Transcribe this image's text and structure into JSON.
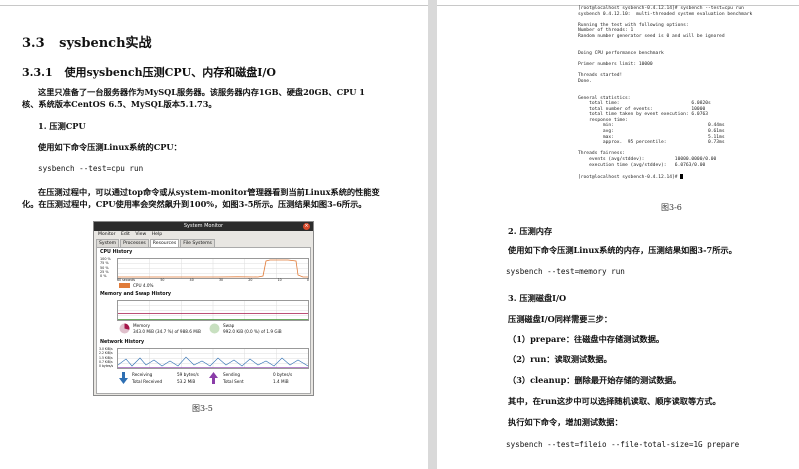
{
  "left_page": {
    "section_number": "3.3",
    "section_title": "sysbench实战",
    "subsection_number": "3.3.1",
    "subsection_title": "使用sysbench压测CPU、内存和磁盘I/O",
    "intro_line1": "这里只准备了一台服务器作为MySQL服务器。该服务器内存1GB、硬盘20GB、CPU  1",
    "intro_line2": "核、系统版本CentOS 6.5、MySQL版本5.1.73。",
    "item1_title": "1. 压测CPU",
    "item1_text": "使用如下命令压测Linux系统的CPU：",
    "item1_command": "sysbench --test=cpu run",
    "item1_para_line1": "在压测过程中，可以通过top命令或从system-monitor管理器看到当前Linux系统的性能变",
    "item1_para_line2": "化。在压测过程中，CPU使用率会突然飙升到100%，如图3-5所示。压测结果如图3-6所示。",
    "figure_caption": "图3-5"
  },
  "system_monitor": {
    "title": "System Monitor",
    "close_glyph": "×",
    "menu": [
      "Monitor",
      "Edit",
      "View",
      "Help"
    ],
    "tabs": [
      "System",
      "Processes",
      "Resources",
      "File Systems"
    ],
    "active_tab": "Resources",
    "cpu_history_label": "CPU History",
    "cpu_legend": "CPU  4.0%",
    "memory_label": "Memory and Swap History",
    "memory_name": "Memory",
    "memory_value": "343.0 MiB (34.7 %) of 988.6 MiB",
    "swap_name": "Swap",
    "swap_value": "992.0 KiB (0.0 %) of 1.9 GiB",
    "network_label": "Network History",
    "receiving_label": "Receiving",
    "receiving_rate": "59 bytes/s",
    "total_received_label": "Total Received",
    "total_received": "53.2 MiB",
    "sending_label": "Sending",
    "sending_rate": "0 bytes/s",
    "total_sent_label": "Total Sent",
    "total_sent": "1.4 MiB",
    "y_ticks_percent": [
      "100 %",
      "75 %",
      "50 %",
      "25 %",
      "0 %"
    ],
    "x_ticks": [
      "60 seconds",
      "50",
      "40",
      "30",
      "20",
      "10",
      "0"
    ],
    "net_ticks": [
      "3.0 KiB/s",
      "2.2 KiB/s",
      "1.5 KiB/s",
      "0.7 KiB/s",
      "0 bytes/s"
    ],
    "colors": {
      "cpu": "#e07b39",
      "memory": "#a6174a",
      "swap": "#3a8e2e",
      "receiving": "#2e6fb3",
      "sending": "#8a3da8"
    }
  },
  "terminal": {
    "lines": [
      "[root@localhost sysbench-0.4.12.14]# sysbench --test=cpu run",
      "sysbench 0.4.12.10:  multi-threaded system evaluation benchmark",
      "",
      "Running the test with following options:",
      "Number of threads: 1",
      "Random number generator seed is 0 and will be ignored",
      "",
      "",
      "Doing CPU performance benchmark",
      "",
      "Primer numbers limit: 10000",
      "",
      "Threads started!",
      "Done.",
      "",
      "",
      "General statistics:",
      "    total time:                          6.0820s",
      "    total number of events:              10000",
      "    total time taken by event execution: 6.0763",
      "    response time:",
      "         min:                                  0.44ms",
      "         avg:                                  0.61ms",
      "         max:                                  5.11ms",
      "         approx.  95 percentile:               0.73ms",
      "",
      "Threads fairness:",
      "    events (avg/stddev):           10000.0000/0.00",
      "    execution time (avg/stddev):   6.0763/0.00",
      "",
      "[root@localhost sysbench-0.4.12.14]# "
    ],
    "caption": "图3-6"
  },
  "right_page": {
    "item2_title": "2. 压测内存",
    "item2_text": "使用如下命令压测Linux系统的内存，压测结果如图3-7所示。",
    "item2_command": "sysbench  --test=memory run",
    "item3_title": "3. 压测磁盘I/O",
    "item3_text": "压测磁盘I/O同样需要三步：",
    "step1": "（1）prepare：往磁盘中存储测试数据。",
    "step2": "（2）run：读取测试数据。",
    "step3": "（3）cleanup：删除最开始存储的测试数据。",
    "para": "其中，在run这步中可以选择随机读取、顺序读取等方式。",
    "exec_text": "执行如下命令，增加测试数据：",
    "item3_command": "sysbench --test=fileio --file-total-size=1G prepare"
  }
}
